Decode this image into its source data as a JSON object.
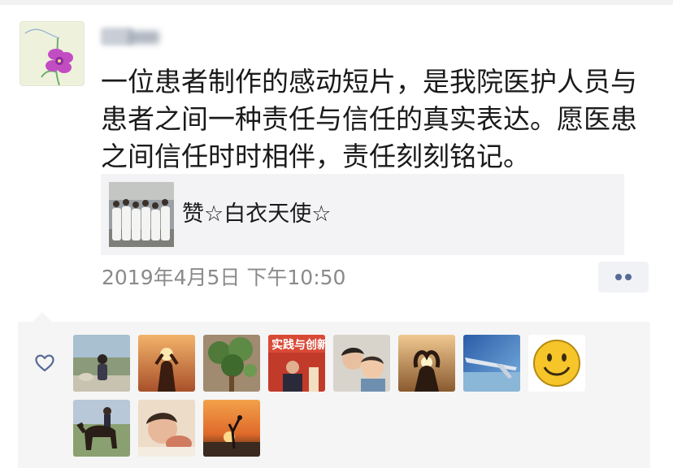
{
  "post": {
    "text": "一位患者制作的感动短片，是我院医护人员与患者之间一种责任与信任的真实表达。愿医患之间信任时时相伴，责任刻刻铭记。",
    "link_card": {
      "title": "赞☆白衣天使☆"
    },
    "timestamp": "2019年4月5日 下午10:50"
  },
  "likes": {
    "avatar_count": 11,
    "avatar_banner_text": "实践与创新"
  },
  "colors": {
    "link_blue": "#586b95",
    "timestamp_gray": "#8a8a8a",
    "card_bg": "#f3f3f5",
    "likes_bg": "#f5f5f5"
  },
  "icons": [
    "heart-icon",
    "more-options-icon"
  ]
}
